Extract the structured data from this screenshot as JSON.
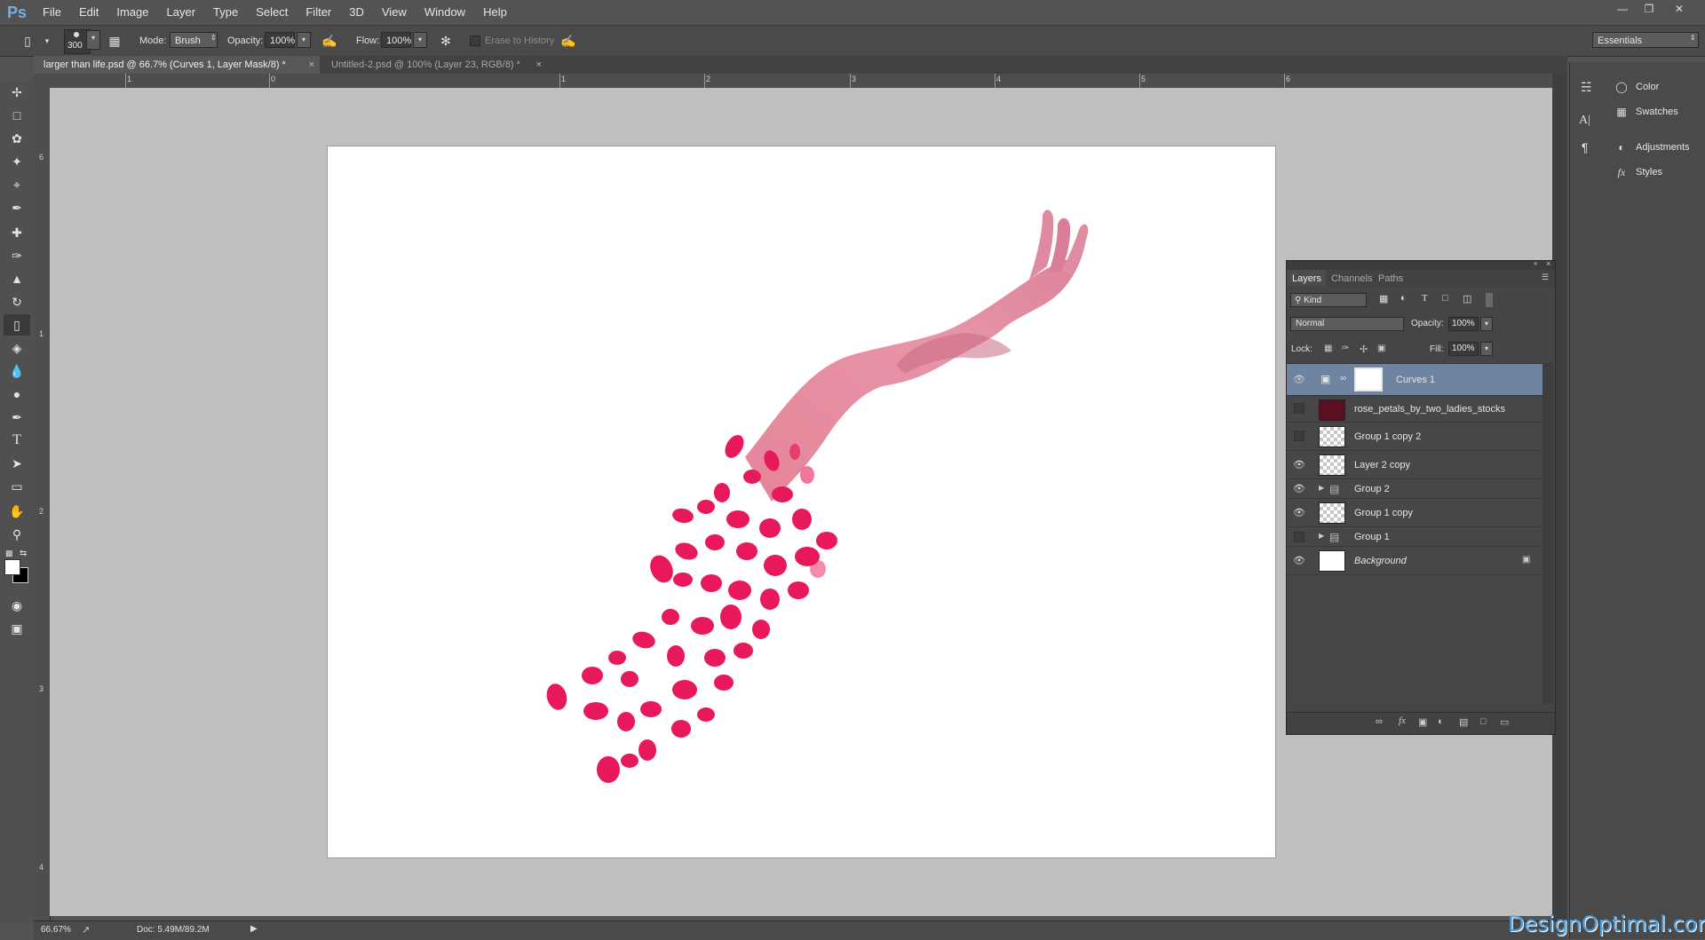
{
  "app": {
    "logo": "Ps",
    "workspace": "Essentials"
  },
  "menu": [
    "File",
    "Edit",
    "Image",
    "Layer",
    "Type",
    "Select",
    "Filter",
    "3D",
    "View",
    "Window",
    "Help"
  ],
  "options": {
    "brush_size": "300",
    "mode_label": "Mode:",
    "mode_value": "Brush",
    "opacity_label": "Opacity:",
    "opacity_value": "100%",
    "flow_label": "Flow:",
    "flow_value": "100%",
    "erase_history": "Erase to History"
  },
  "tabs": [
    {
      "label": "larger than life.psd @ 66.7% (Curves 1, Layer Mask/8) *",
      "active": true
    },
    {
      "label": "Untitled-2.psd @ 100% (Layer 23, RGB/8) *",
      "active": false
    }
  ],
  "rulers": {
    "top": [
      "1",
      "0",
      "1",
      "2",
      "3",
      "4",
      "5",
      "6"
    ],
    "left": [
      "6",
      "1",
      "2",
      "3",
      "4"
    ]
  },
  "status": {
    "zoom": "66.67%",
    "doc": "Doc: 5.49M/89.2M"
  },
  "right_panels": [
    "Color",
    "Swatches",
    "Adjustments",
    "Styles"
  ],
  "layers_panel": {
    "tabs": [
      "Layers",
      "Channels",
      "Paths"
    ],
    "filter_kind": "Kind",
    "blend_mode": "Normal",
    "opacity_label": "Opacity:",
    "opacity_value": "100%",
    "lock_label": "Lock:",
    "fill_label": "Fill:",
    "fill_value": "100%",
    "layers": [
      {
        "name": "Curves 1",
        "visible": true,
        "selected": true
      },
      {
        "name": "rose_petals_by_two_ladies_stocks",
        "visible": false
      },
      {
        "name": "Group 1 copy 2",
        "visible": false
      },
      {
        "name": "Layer 2 copy",
        "visible": true
      },
      {
        "name": "Group 2",
        "visible": true
      },
      {
        "name": "Group 1 copy",
        "visible": true
      },
      {
        "name": "Group 1",
        "visible": false
      },
      {
        "name": "Background",
        "visible": true
      }
    ]
  },
  "watermark": "DesignOptimal.com"
}
